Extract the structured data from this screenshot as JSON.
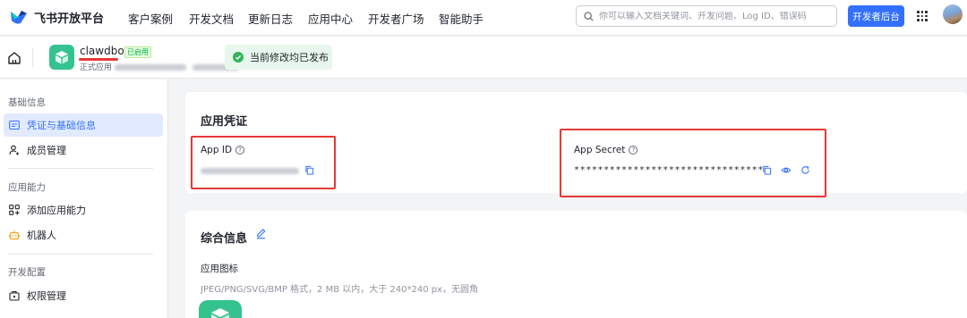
{
  "nav": {
    "logo_text": "飞书开放平台",
    "items": [
      "客户案例",
      "开发文档",
      "更新日志",
      "应用中心",
      "开发者广场",
      "智能助手"
    ],
    "search_placeholder": "你可以输入文档关键词、开发问题、Log ID、错误码",
    "console_button": "开发者后台",
    "icons": {
      "search": "search-icon",
      "apps": "grid-icon",
      "avatar": "user-avatar"
    }
  },
  "app": {
    "name": "clawdbot",
    "badge": "已启用",
    "subtitle_prefix": "正式应用",
    "status": "当前修改均已发布"
  },
  "sidebar": {
    "groups": [
      {
        "label": "基础信息",
        "items": [
          {
            "label": "凭证与基础信息",
            "active": true
          },
          {
            "label": "成员管理"
          }
        ]
      },
      {
        "label": "应用能力",
        "items": [
          {
            "label": "添加应用能力"
          },
          {
            "label": "机器人"
          }
        ]
      },
      {
        "label": "开发配置",
        "items": [
          {
            "label": "权限管理"
          }
        ]
      }
    ]
  },
  "credentials": {
    "title": "应用凭证",
    "app_id_label": "App ID",
    "app_secret_label": "App Secret",
    "app_secret_value": "********************************"
  },
  "general": {
    "title": "综合信息",
    "icon_label": "应用图标",
    "icon_hint": "JPEG/PNG/SVG/BMP 格式，2 MB 以内，大于 240*240 px，无圆角"
  },
  "colors": {
    "accent": "#3370ff",
    "success": "#34b35b",
    "annotation": "#e53935",
    "brand_green": "#34c38f"
  }
}
